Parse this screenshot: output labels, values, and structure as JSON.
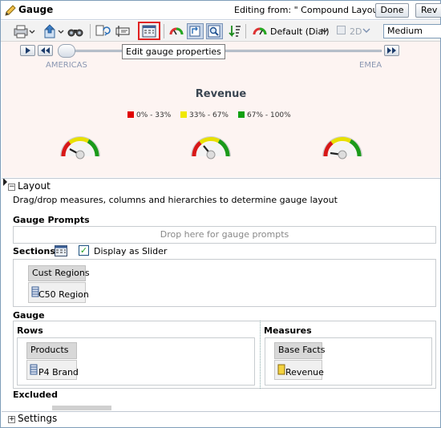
{
  "window": {
    "title": "Gauge",
    "editing_from": "Editing from: \" Compound Layout\"",
    "done_label": "Done",
    "rev_label": "Rev"
  },
  "toolbar": {
    "icons": [
      "print-icon",
      "export-icon",
      "preview-icon",
      "refresh-icon",
      "edit-properties-icon",
      "gauge-type-icon",
      "rotate-icon",
      "zoom-icon",
      "sort-icon"
    ],
    "gauge_style_label": "Default (Dial)",
    "dimension_label": "2D",
    "size_value": "Medium",
    "tooltip": "Edit gauge properties"
  },
  "preview": {
    "slider_left_label": "AMERICAS",
    "slider_right_label": "EMEA",
    "chart_title": "Revenue",
    "legend": [
      {
        "label": "0% - 33%",
        "color": "#e00000"
      },
      {
        "label": "33% - 67%",
        "color": "#f0e800"
      },
      {
        "label": "67% - 100%",
        "color": "#10a010"
      }
    ]
  },
  "layout": {
    "header": "Layout",
    "instructions": "Drag/drop measures, columns and hierarchies to determine gauge layout",
    "gauge_prompts_label": "Gauge Prompts",
    "gauge_prompts_drop": "Drop here for gauge prompts",
    "sections_label": "Sections",
    "display_as_slider_label": "Display as Slider",
    "section_group": "Cust Regions",
    "section_item": "C50 Region",
    "gauge_label": "Gauge",
    "rows_label": "Rows",
    "rows_group": "Products",
    "rows_item": "P4 Brand",
    "measures_label": "Measures",
    "measures_group": "Base Facts",
    "measures_item": "Revenue",
    "excluded_label": "Excluded",
    "settings_header": "Settings"
  }
}
